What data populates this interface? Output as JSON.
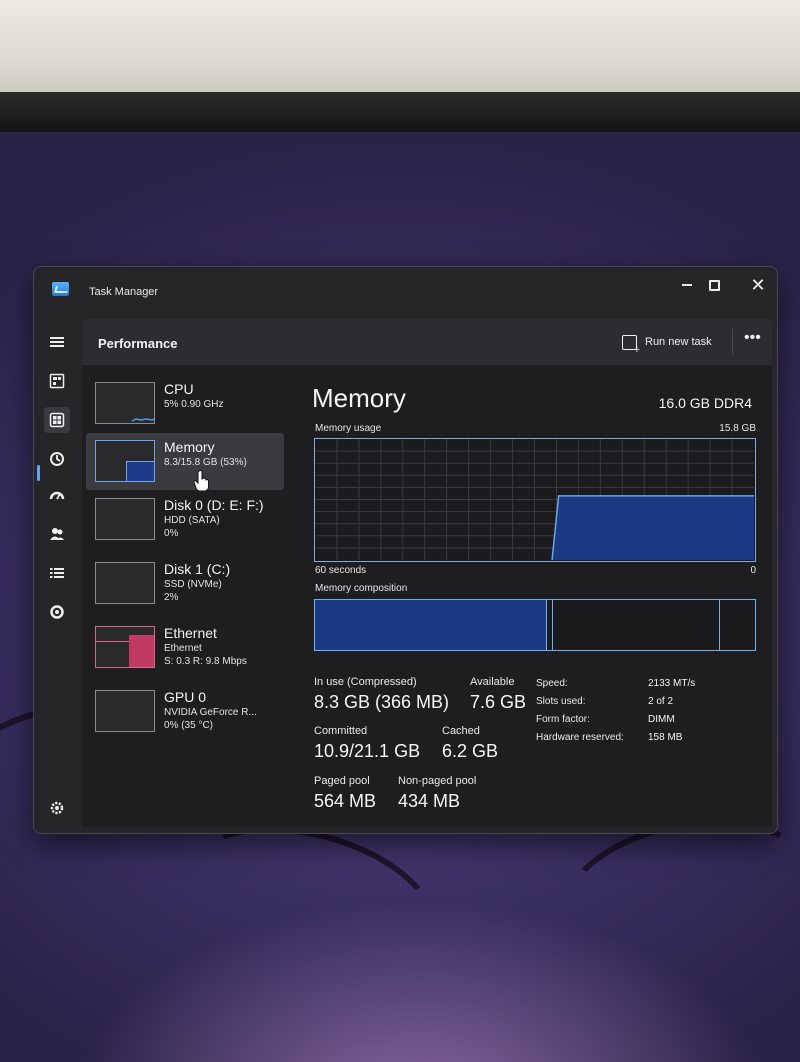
{
  "window": {
    "title": "Task Manager",
    "minimize_glyph": "",
    "close_glyph": "✕"
  },
  "nav": [
    {
      "icon": "hamburger-icon"
    },
    {
      "icon": "processes-icon"
    },
    {
      "icon": "performance-icon",
      "active": true
    },
    {
      "icon": "app-history-icon"
    },
    {
      "icon": "startup-apps-icon"
    },
    {
      "icon": "users-icon"
    },
    {
      "icon": "details-icon"
    },
    {
      "icon": "services-icon"
    },
    {
      "icon": "settings-icon"
    }
  ],
  "header": {
    "title": "Performance",
    "run_new_task": "Run new task",
    "more": "•••"
  },
  "resources": [
    {
      "name": "CPU",
      "sub1": "5% 0.90 GHz",
      "sub2": ""
    },
    {
      "name": "Memory",
      "sub1": "8.3/15.8 GB (53%)",
      "sub2": "",
      "selected": true
    },
    {
      "name": "Disk 0 (D: E: F:)",
      "sub1": "HDD (SATA)",
      "sub2": "0%"
    },
    {
      "name": "Disk 1 (C:)",
      "sub1": "SSD (NVMe)",
      "sub2": "2%"
    },
    {
      "name": "Ethernet",
      "sub1": "Ethernet",
      "sub2": "S: 0.3  R: 9.8 Mbps"
    },
    {
      "name": "GPU 0",
      "sub1": "NVIDIA GeForce R...",
      "sub2": "0% (35 °C)"
    }
  ],
  "detail": {
    "title": "Memory",
    "spec": "16.0 GB DDR4",
    "usage_label": "Memory usage",
    "usage_max": "15.8 GB",
    "time_label": "60 seconds",
    "time_min": "0",
    "composition_label": "Memory composition",
    "usage_fraction": 0.53
  },
  "stats": {
    "in_use_label": "In use (Compressed)",
    "in_use_value": "8.3 GB (366 MB)",
    "available_label": "Available",
    "available_value": "7.6 GB",
    "committed_label": "Committed",
    "committed_value": "10.9/21.1 GB",
    "cached_label": "Cached",
    "cached_value": "6.2 GB",
    "paged_label": "Paged pool",
    "paged_value": "564 MB",
    "nonpaged_label": "Non-paged pool",
    "nonpaged_value": "434 MB"
  },
  "specs": {
    "speed_label": "Speed:",
    "speed_value": "2133 MT/s",
    "slots_label": "Slots used:",
    "slots_value": "2 of 2",
    "form_label": "Form factor:",
    "form_value": "DIMM",
    "reserved_label": "Hardware reserved:",
    "reserved_value": "158 MB"
  },
  "colors": {
    "accent": "#5aa6ff",
    "memory_fill": "#1c3a84",
    "memory_line": "#6aa6e8",
    "ethernet": "#d06a86"
  }
}
